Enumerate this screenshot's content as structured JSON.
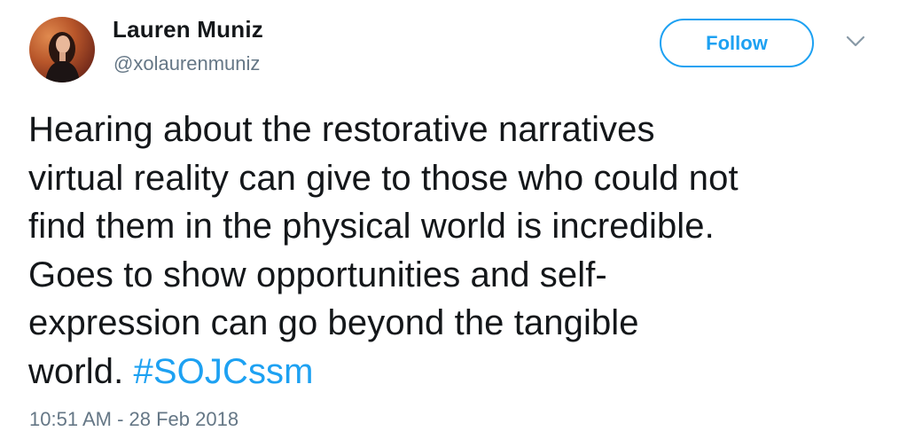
{
  "user": {
    "display_name": "Lauren Muniz",
    "handle": "@xolaurenmuniz"
  },
  "actions": {
    "follow_label": "Follow",
    "menu_icon": "chevron-down-icon"
  },
  "tweet": {
    "text": "Hearing about the restorative narratives\nvirtual reality can give to those who could not\nfind them in the physical world is incredible.\nGoes to show opportunities and self-\nexpression can go beyond the tangible\nworld. ",
    "hashtag": "#SOJCssm",
    "timestamp": "10:51 AM - 28 Feb 2018"
  },
  "colors": {
    "accent": "#1da1f2",
    "text": "#14171a",
    "muted": "#657786"
  }
}
